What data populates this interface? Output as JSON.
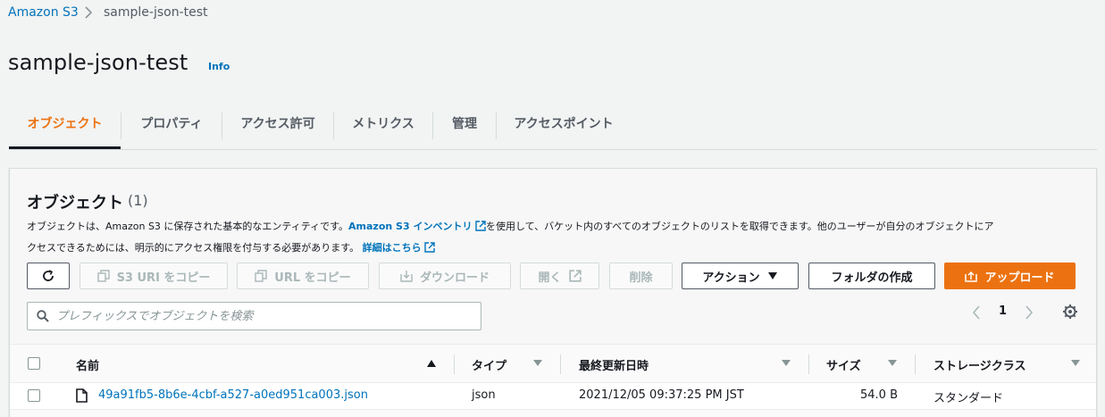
{
  "breadcrumb": {
    "root": "Amazon S3",
    "current": "sample-json-test"
  },
  "page": {
    "title": "sample-json-test",
    "info": "Info"
  },
  "tabs": [
    {
      "label": "オブジェクト",
      "active": true
    },
    {
      "label": "プロパティ"
    },
    {
      "label": "アクセス許可"
    },
    {
      "label": "メトリクス"
    },
    {
      "label": "管理"
    },
    {
      "label": "アクセスポイント"
    }
  ],
  "objects": {
    "heading": "オブジェクト",
    "count": "(1)",
    "desc_part1": "オブジェクトは、Amazon S3 に保存された基本的なエンティティです。",
    "desc_link1": "Amazon S3 インベントリ",
    "desc_part2": "を使用して、バケット内のすべてのオブジェクトのリストを取得できます。他のユーザーが自分のオブジェクトにア",
    "desc_part3": "クセスできるためには、明示的にアクセス権限を付与する必要があります。",
    "desc_link2": "詳細はこちら"
  },
  "toolbar": {
    "refresh": "refresh-icon",
    "copy_s3_uri": "S3 URI をコピー",
    "copy_url": "URL をコピー",
    "download": "ダウンロード",
    "open": "開く",
    "delete": "削除",
    "actions": "アクション",
    "create_folder": "フォルダの作成",
    "upload": "アップロード"
  },
  "search": {
    "placeholder": "プレフィックスでオブジェクトを検索"
  },
  "pagination": {
    "page": "1"
  },
  "table": {
    "columns": [
      "名前",
      "タイプ",
      "最終更新日時",
      "サイズ",
      "ストレージクラス"
    ],
    "rows": [
      {
        "name": "49a91fb5-8b6e-4cbf-a527-a0ed951ca003.json",
        "type": "json",
        "modified": "2021/12/05 09:37:25 PM JST",
        "size": "54.0 B",
        "storage_class": "スタンダード"
      }
    ]
  },
  "colors": {
    "accent": "#ec7211",
    "link": "#0073bb",
    "text": "#16191f",
    "muted": "#545b64"
  }
}
